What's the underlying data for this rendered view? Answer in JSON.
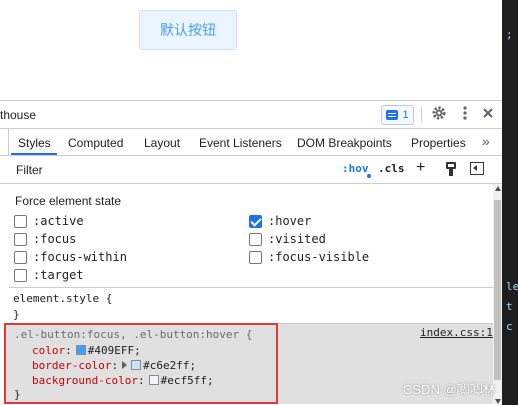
{
  "preview": {
    "button_label": "默认按钮"
  },
  "right_strip": {
    "marks": [
      ";",
      "le",
      "t",
      "c"
    ]
  },
  "toolbar": {
    "panel_name": "thouse",
    "messages_count": "1",
    "settings_icon": "gear-icon",
    "more_icon": "kebab-icon",
    "close_icon": "close-icon"
  },
  "tabs": [
    {
      "label": "Styles",
      "active": true
    },
    {
      "label": "Computed"
    },
    {
      "label": "Layout"
    },
    {
      "label": "Event Listeners"
    },
    {
      "label": "DOM Breakpoints"
    },
    {
      "label": "Properties"
    }
  ],
  "tabs_more": "»",
  "filter": {
    "placeholder": "Filter",
    "hov": ":hov",
    "cls": ".cls",
    "add": "+"
  },
  "force_state": {
    "title": "Force element state",
    "states": [
      {
        "label": ":active",
        "checked": false
      },
      {
        "label": ":hover",
        "checked": true
      },
      {
        "label": ":focus",
        "checked": false
      },
      {
        "label": ":visited",
        "checked": false
      },
      {
        "label": ":focus-within",
        "checked": false
      },
      {
        "label": ":focus-visible",
        "checked": false
      },
      {
        "label": ":target",
        "checked": false
      }
    ]
  },
  "element_style": {
    "open": "element.style {",
    "close": "}"
  },
  "rule": {
    "selector": ".el-button:focus, .el-button:hover {",
    "source": "index.css:1",
    "declarations": [
      {
        "prop": "color",
        "value": "#409EFF",
        "swatch": "#409EFF",
        "expandable": false
      },
      {
        "prop": "border-color",
        "value": "#c6e2ff",
        "swatch": "#c6e2ff",
        "expandable": true
      },
      {
        "prop": "background-color",
        "value": "#ecf5ff",
        "swatch": "#ecf5ff",
        "expandable": false
      }
    ],
    "close": "}"
  },
  "watermark": "CSDN @唧唧林"
}
